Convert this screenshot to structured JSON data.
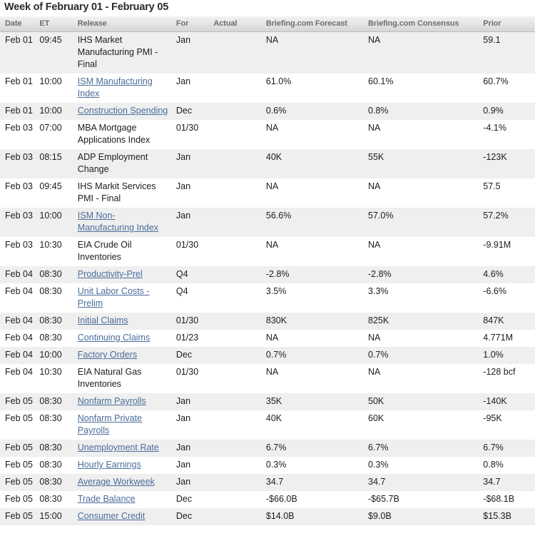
{
  "calendar": {
    "title": "Week of February 01 - February 05",
    "columns": [
      {
        "key": "date",
        "label": "Date"
      },
      {
        "key": "et",
        "label": "ET"
      },
      {
        "key": "release",
        "label": "Release"
      },
      {
        "key": "for",
        "label": "For"
      },
      {
        "key": "actual",
        "label": "Actual"
      },
      {
        "key": "forecast",
        "label": "Briefing.com Forecast"
      },
      {
        "key": "consensus",
        "label": "Briefing.com Consensus"
      },
      {
        "key": "prior",
        "label": "Prior"
      }
    ],
    "link_color": "#4a6d9a",
    "header_text_color": "#6e6e6e",
    "row_alt_color": "#efefef",
    "rows": [
      {
        "date": "Feb 01",
        "et": "09:45",
        "release": "IHS Market Manufacturing PMI - Final",
        "is_link": false,
        "for": "Jan",
        "actual": "",
        "forecast": "NA",
        "consensus": "NA",
        "prior": "59.1"
      },
      {
        "date": "Feb 01",
        "et": "10:00",
        "release": "ISM Manufacturing Index",
        "is_link": true,
        "for": "Jan",
        "actual": "",
        "forecast": "61.0%",
        "consensus": "60.1%",
        "prior": "60.7%"
      },
      {
        "date": "Feb 01",
        "et": "10:00",
        "release": "Construction Spending",
        "is_link": true,
        "for": "Dec",
        "actual": "",
        "forecast": "0.6%",
        "consensus": "0.8%",
        "prior": "0.9%"
      },
      {
        "date": "Feb 03",
        "et": "07:00",
        "release": "MBA Mortgage Applications Index",
        "is_link": false,
        "for": "01/30",
        "actual": "",
        "forecast": "NA",
        "consensus": "NA",
        "prior": "-4.1%"
      },
      {
        "date": "Feb 03",
        "et": "08:15",
        "release": "ADP Employment Change",
        "is_link": false,
        "for": "Jan",
        "actual": "",
        "forecast": "40K",
        "consensus": "55K",
        "prior": "-123K"
      },
      {
        "date": "Feb 03",
        "et": "09:45",
        "release": "IHS Markit Services PMI - Final",
        "is_link": false,
        "for": "Jan",
        "actual": "",
        "forecast": "NA",
        "consensus": "NA",
        "prior": "57.5"
      },
      {
        "date": "Feb 03",
        "et": "10:00",
        "release": "ISM Non-Manufacturing Index",
        "is_link": true,
        "for": "Jan",
        "actual": "",
        "forecast": "56.6%",
        "consensus": "57.0%",
        "prior": "57.2%"
      },
      {
        "date": "Feb 03",
        "et": "10:30",
        "release": "EIA Crude Oil Inventories",
        "is_link": false,
        "for": "01/30",
        "actual": "",
        "forecast": "NA",
        "consensus": "NA",
        "prior": "-9.91M"
      },
      {
        "date": "Feb 04",
        "et": "08:30",
        "release": "Productivity-Prel",
        "is_link": true,
        "for": "Q4",
        "actual": "",
        "forecast": "-2.8%",
        "consensus": "-2.8%",
        "prior": "4.6%"
      },
      {
        "date": "Feb 04",
        "et": "08:30",
        "release": "Unit Labor Costs - Prelim",
        "is_link": true,
        "for": "Q4",
        "actual": "",
        "forecast": "3.5%",
        "consensus": "3.3%",
        "prior": "-6.6%"
      },
      {
        "date": "Feb 04",
        "et": "08:30",
        "release": "Initial Claims",
        "is_link": true,
        "for": "01/30",
        "actual": "",
        "forecast": "830K",
        "consensus": "825K",
        "prior": "847K"
      },
      {
        "date": "Feb 04",
        "et": "08:30",
        "release": "Continuing Claims",
        "is_link": true,
        "for": "01/23",
        "actual": "",
        "forecast": "NA",
        "consensus": "NA",
        "prior": "4.771M"
      },
      {
        "date": "Feb 04",
        "et": "10:00",
        "release": "Factory Orders",
        "is_link": true,
        "for": "Dec",
        "actual": "",
        "forecast": "0.7%",
        "consensus": "0.7%",
        "prior": "1.0%"
      },
      {
        "date": "Feb 04",
        "et": "10:30",
        "release": "EIA Natural Gas Inventories",
        "is_link": false,
        "for": "01/30",
        "actual": "",
        "forecast": "NA",
        "consensus": "NA",
        "prior": "-128 bcf"
      },
      {
        "date": "Feb 05",
        "et": "08:30",
        "release": "Nonfarm Payrolls",
        "is_link": true,
        "for": "Jan",
        "actual": "",
        "forecast": "35K",
        "consensus": "50K",
        "prior": "-140K"
      },
      {
        "date": "Feb 05",
        "et": "08:30",
        "release": "Nonfarm Private Payrolls",
        "is_link": true,
        "for": "Jan",
        "actual": "",
        "forecast": "40K",
        "consensus": "60K",
        "prior": "-95K"
      },
      {
        "date": "Feb 05",
        "et": "08:30",
        "release": "Unemployment Rate",
        "is_link": true,
        "for": "Jan",
        "actual": "",
        "forecast": "6.7%",
        "consensus": "6.7%",
        "prior": "6.7%"
      },
      {
        "date": "Feb 05",
        "et": "08:30",
        "release": "Hourly Earnings",
        "is_link": true,
        "for": "Jan",
        "actual": "",
        "forecast": "0.3%",
        "consensus": "0.3%",
        "prior": "0.8%"
      },
      {
        "date": "Feb 05",
        "et": "08:30",
        "release": "Average Workweek",
        "is_link": true,
        "for": "Jan",
        "actual": "",
        "forecast": "34.7",
        "consensus": "34.7",
        "prior": "34.7"
      },
      {
        "date": "Feb 05",
        "et": "08:30",
        "release": "Trade Balance",
        "is_link": true,
        "for": "Dec",
        "actual": "",
        "forecast": "-$66.0B",
        "consensus": "-$65.7B",
        "prior": "-$68.1B"
      },
      {
        "date": "Feb 05",
        "et": "15:00",
        "release": "Consumer Credit",
        "is_link": true,
        "for": "Dec",
        "actual": "",
        "forecast": "$14.0B",
        "consensus": "$9.0B",
        "prior": "$15.3B"
      }
    ]
  }
}
